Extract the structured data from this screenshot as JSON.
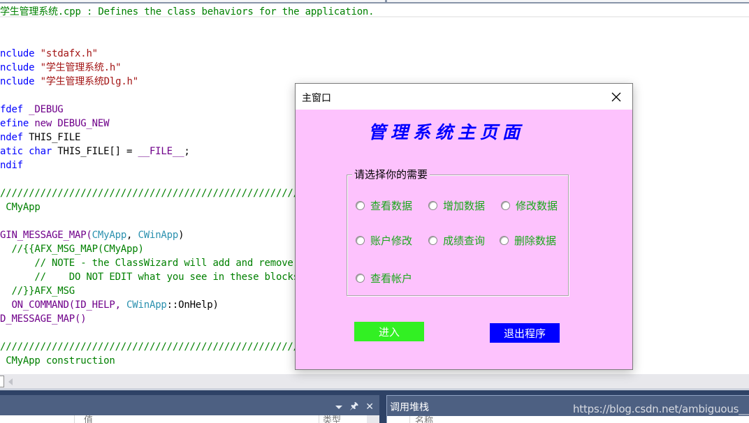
{
  "editor": {
    "lines": [
      {
        "parts": [
          {
            "t": "学生管理系统.cpp : Defines the class behaviors for the application.",
            "c": "c-green"
          }
        ]
      },
      {
        "parts": [
          {
            "t": "nclude ",
            "c": "c-blue"
          },
          {
            "t": "\"stdafx.h\"",
            "c": "c-str"
          }
        ]
      },
      {
        "parts": [
          {
            "t": "nclude ",
            "c": "c-blue"
          },
          {
            "t": "\"学生管理系统.h\"",
            "c": "c-str"
          }
        ]
      },
      {
        "parts": [
          {
            "t": "nclude ",
            "c": "c-blue"
          },
          {
            "t": "\"学生管理系统Dlg.h\"",
            "c": "c-str"
          }
        ]
      },
      {
        "parts": [
          {
            "t": "fdef ",
            "c": "c-blue"
          },
          {
            "t": "_DEBUG",
            "c": "c-macro"
          }
        ]
      },
      {
        "parts": [
          {
            "t": "efine ",
            "c": "c-blue"
          },
          {
            "t": "new DEBUG_NEW",
            "c": "c-macro"
          }
        ]
      },
      {
        "parts": [
          {
            "t": "ndef ",
            "c": "c-blue"
          },
          {
            "t": "THIS_FILE",
            "c": "c-black"
          }
        ]
      },
      {
        "parts": [
          {
            "t": "atic char ",
            "c": "c-blue"
          },
          {
            "t": "THIS_FILE[] = ",
            "c": "c-black"
          },
          {
            "t": "__FILE__",
            "c": "c-macro"
          },
          {
            "t": ";",
            "c": "c-black"
          }
        ]
      },
      {
        "parts": [
          {
            "t": "ndif",
            "c": "c-blue"
          }
        ]
      },
      {
        "parts": [
          {
            "t": "///////////////////////////////////////////////////////////////////////////",
            "c": "c-green"
          }
        ]
      },
      {
        "parts": [
          {
            "t": " CMyApp",
            "c": "c-green"
          }
        ]
      },
      {
        "parts": [
          {
            "t": "GIN_MESSAGE_MAP(",
            "c": "c-macro"
          },
          {
            "t": "CMyApp",
            "c": "c-type"
          },
          {
            "t": ", ",
            "c": "c-black"
          },
          {
            "t": "CWinApp",
            "c": "c-type"
          },
          {
            "t": ")",
            "c": "c-black"
          }
        ]
      },
      {
        "parts": [
          {
            "t": "  //{{AFX_MSG_MAP(CMyApp)",
            "c": "c-green"
          }
        ]
      },
      {
        "parts": [
          {
            "t": "      // NOTE - the ClassWizard will add and remove mapping macros here.",
            "c": "c-green"
          }
        ]
      },
      {
        "parts": [
          {
            "t": "      //    DO NOT EDIT what you see in these blocks of generated code!",
            "c": "c-green"
          }
        ]
      },
      {
        "parts": [
          {
            "t": "  //}}AFX_MSG",
            "c": "c-green"
          }
        ]
      },
      {
        "parts": [
          {
            "t": "  ON_COMMAND(ID_HELP, ",
            "c": "c-macro"
          },
          {
            "t": "CWinApp",
            "c": "c-type"
          },
          {
            "t": "::OnHelp)",
            "c": "c-black"
          }
        ]
      },
      {
        "parts": [
          {
            "t": "D_MESSAGE_MAP()",
            "c": "c-macro"
          }
        ]
      },
      {
        "parts": [
          {
            "t": "///////////////////////////////////////////////////////////////////////////",
            "c": "c-green"
          }
        ]
      },
      {
        "parts": [
          {
            "t": " CMyApp construction",
            "c": "c-green"
          }
        ]
      }
    ]
  },
  "bottom": {
    "left_panel": {
      "col_value": "值",
      "col_type": "类型"
    },
    "right_panel": {
      "title": "调用堆栈",
      "col_name": "名称"
    },
    "watermark": "https://blog.csdn.net/ambiguous__"
  },
  "dialog": {
    "title": "主窗口",
    "heading": "管理系统主页面",
    "group_label": "请选择你的需要",
    "options": [
      {
        "label": "查看数据",
        "selected": false
      },
      {
        "label": "增加数据",
        "selected": false
      },
      {
        "label": "修改数据",
        "selected": false
      },
      {
        "label": "账户修改",
        "selected": false
      },
      {
        "label": "成绩查询",
        "selected": false
      },
      {
        "label": "删除数据",
        "selected": false
      },
      {
        "label": "查看帐户",
        "selected": false
      }
    ],
    "enter_button": "进入",
    "exit_button": "退出程序",
    "colors": {
      "background": "#fdc2fd",
      "heading": "#0000ff",
      "option_text": "#1aa81a",
      "enter_bg": "#32f023",
      "exit_bg": "#0000ff"
    }
  }
}
